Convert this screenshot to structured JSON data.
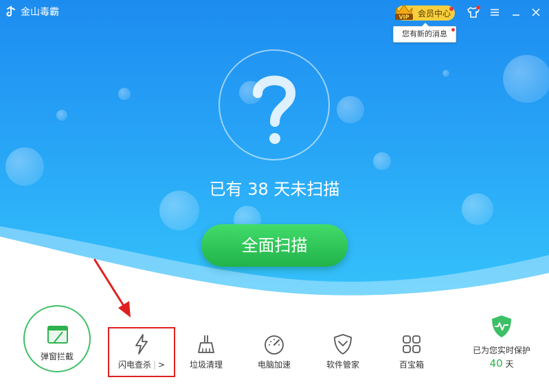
{
  "app": {
    "title": "金山毒霸"
  },
  "header": {
    "vip_label": "会员中心",
    "vip_badge_text": "VIP",
    "tooltip": "您有新的消息"
  },
  "main": {
    "status_text": "已有 38 天未扫描",
    "scan_button": "全面扫描"
  },
  "toolbar": {
    "popup_block": "弹窗拦截",
    "flash_scan": "闪电查杀",
    "flash_arrow": ">",
    "flash_sep": "|",
    "junk_clean": "垃圾清理",
    "pc_speed": "电脑加速",
    "software_mgr": "软件管家",
    "toolbox": "百宝箱"
  },
  "protection": {
    "text": "已为您实时保护",
    "days": "40",
    "unit": "天"
  },
  "colors": {
    "hero_top": "#1d8cf0",
    "hero_bottom": "#35c3fb",
    "scan_green": "#2fc153",
    "accent_green": "#2fb24d",
    "vip_gold": "#f7cf3e",
    "highlight_red": "#e02020"
  }
}
